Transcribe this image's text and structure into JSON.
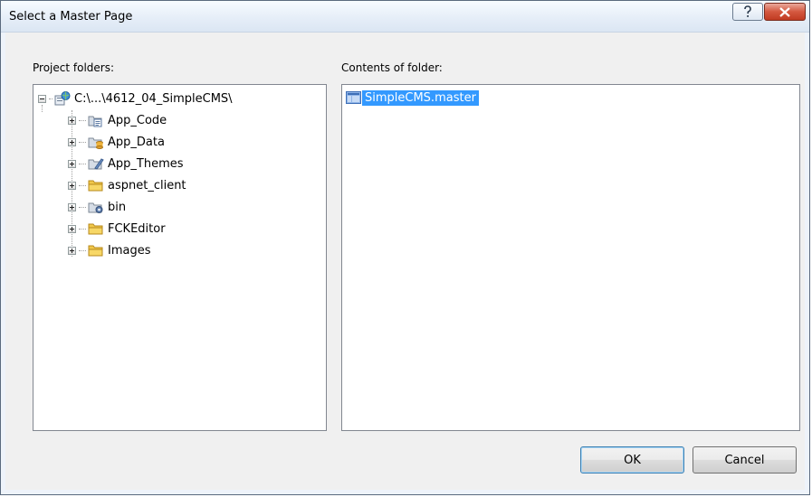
{
  "window": {
    "title": "Select a Master Page"
  },
  "labels": {
    "project_folders": "Project folders:",
    "contents": "Contents of folder:"
  },
  "tree": {
    "root": "C:\\...\\4612_04_SimpleCMS\\",
    "items": [
      "App_Code",
      "App_Data",
      "App_Themes",
      "aspnet_client",
      "bin",
      "FCKEditor",
      "Images"
    ]
  },
  "contents": {
    "files": [
      "SimpleCMS.master"
    ]
  },
  "buttons": {
    "ok": "OK",
    "cancel": "Cancel"
  },
  "colors": {
    "selection": "#3399ff",
    "folder": "#f1c84a",
    "close_button": "#c9452c"
  }
}
